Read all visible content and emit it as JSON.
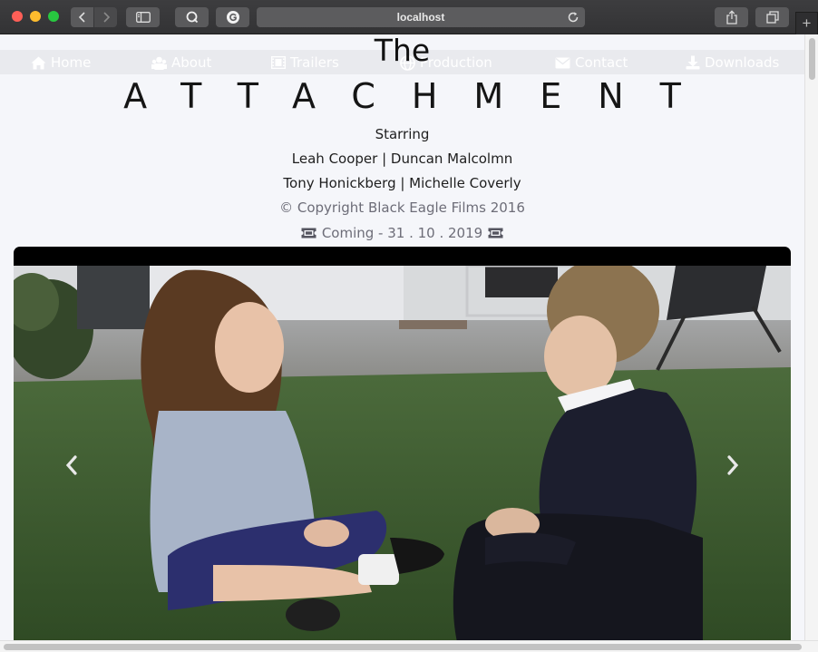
{
  "browser": {
    "address": "localhost",
    "new_tab_label": "+",
    "colors": {
      "close": "#fe5f57",
      "minimize": "#febc2e",
      "zoom": "#28c840"
    }
  },
  "nav": {
    "items": [
      {
        "label": "Home",
        "icon": "home-icon"
      },
      {
        "label": "About",
        "icon": "users-icon"
      },
      {
        "label": "Trailers",
        "icon": "film-icon"
      },
      {
        "label": "Production",
        "icon": "globe-icon"
      },
      {
        "label": "Contact",
        "icon": "envelope-icon"
      },
      {
        "label": "Downloads",
        "icon": "download-icon"
      }
    ]
  },
  "hero": {
    "title_small": "The",
    "title_main": "ATTACHMENT",
    "starring_label": "Starring",
    "cast_line_1": "Leah Cooper | Duncan Malcolmn",
    "cast_line_2": "Tony Honickberg | Michelle Coverly",
    "copyright": "© Copyright Black Eagle Films 2016",
    "coming": "Coming - 31 . 10 . 2019",
    "coming_icon": "ticket-icon"
  },
  "carousel": {
    "prev_icon": "chevron-left-icon",
    "next_icon": "chevron-right-icon",
    "slide_description_icon": "film-still-image"
  }
}
